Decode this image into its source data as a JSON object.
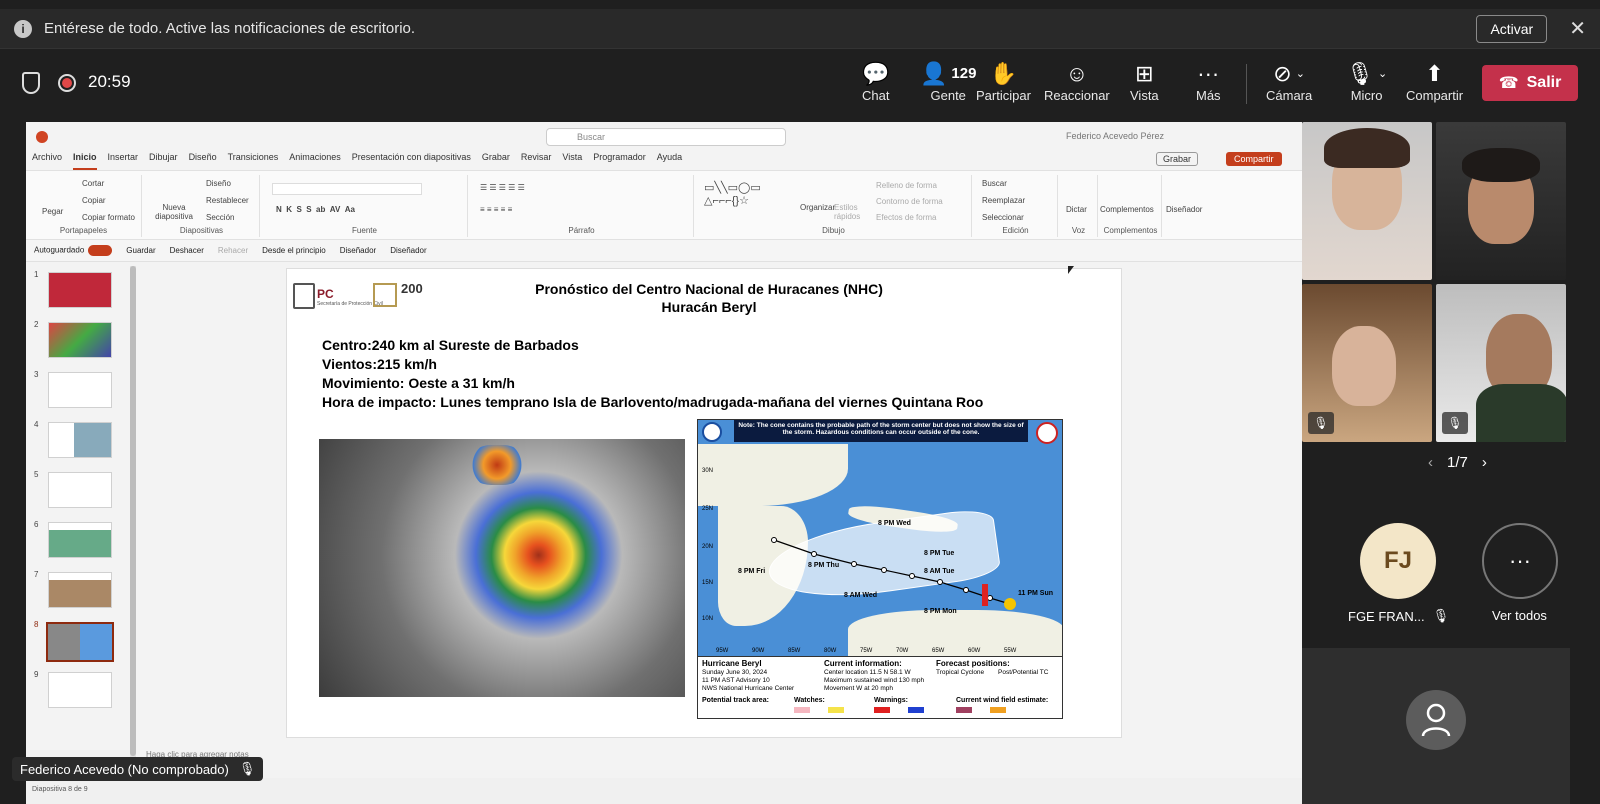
{
  "notification": {
    "text": "Entérese de todo. Active las notificaciones de escritorio.",
    "action": "Activar"
  },
  "call": {
    "timer": "20:59",
    "people_count": "129",
    "leave": "Salir"
  },
  "toolbar": [
    {
      "label": "Chat",
      "icon": "chat-icon"
    },
    {
      "label": "Gente",
      "icon": "people-icon"
    },
    {
      "label": "Participar",
      "icon": "hand-icon"
    },
    {
      "label": "Reaccionar",
      "icon": "smile-icon"
    },
    {
      "label": "Vista",
      "icon": "grid-icon"
    },
    {
      "label": "Más",
      "icon": "more-icon"
    },
    {
      "label": "Cámara",
      "icon": "camera-off-icon"
    },
    {
      "label": "Micro",
      "icon": "mic-off-icon"
    },
    {
      "label": "Compartir",
      "icon": "share-icon"
    }
  ],
  "ppt": {
    "search": "Buscar",
    "user": "Federico Acevedo Pérez",
    "menu": [
      "Archivo",
      "Inicio",
      "Insertar",
      "Dibujar",
      "Diseño",
      "Transiciones",
      "Animaciones",
      "Presentación con diapositivas",
      "Grabar",
      "Revisar",
      "Vista",
      "Programador",
      "Ayuda"
    ],
    "grabar": "Grabar",
    "compartir": "Compartir",
    "ribbon_groups": [
      "Portapapeles",
      "Diapositivas",
      "Fuente",
      "Párrafo",
      "Dibujo",
      "Edición",
      "Voz",
      "Complementos"
    ],
    "clip": {
      "pegar": "Pegar",
      "cortar": "Cortar",
      "copiar": "Copiar",
      "formato": "Copiar formato"
    },
    "slides": {
      "nueva": "Nueva diapositiva",
      "diseno": "Diseño",
      "restablecer": "Restablecer",
      "seccion": "Sección"
    },
    "drawing": {
      "organizar": "Organizar",
      "estilos": "Estilos rápidos",
      "relleno": "Relleno de forma",
      "contorno": "Contorno de forma",
      "efectos": "Efectos de forma"
    },
    "edit": {
      "buscar": "Buscar",
      "reemplazar": "Reemplazar",
      "seleccionar": "Seleccionar"
    },
    "voz": "Dictar",
    "complementos": "Complementos",
    "disenador": "Diseñador",
    "qat": {
      "autoguardado": "Autoguardado",
      "guardar": "Guardar",
      "deshacer": "Deshacer",
      "rehacer": "Rehacer",
      "desde": "Desde el principio",
      "disenador1": "Diseñador",
      "disenador2": "Diseñador"
    },
    "thumbs": [
      "1",
      "2",
      "3",
      "4",
      "5",
      "6",
      "7",
      "8",
      "9"
    ],
    "notes": "Haga clic para agregar notas",
    "status": "Diapositiva 8 de 9"
  },
  "slide": {
    "pc": "PC",
    "pc_sub": "Secretaría de Protección Civil",
    "logo200": "200",
    "title1": "Pronóstico del Centro Nacional de Huracanes (NHC)",
    "title2": "Huracán Beryl",
    "bullets": [
      "Centro:240 km al Sureste de Barbados",
      "Vientos:215 km/h",
      "Movimiento: Oeste a 31 km/h",
      "Hora de impacto: Lunes temprano Isla de Barlovento/madrugada-mañana del viernes Quintana Roo"
    ],
    "map": {
      "note": "Note: The cone contains the probable path of the storm center but does not show the size of the storm. Hazardous conditions can occur outside of the cone.",
      "tracks": [
        "8 PM Wed",
        "8 PM Tue",
        "8 AM Tue",
        "8 PM Fri",
        "8 PM Thu",
        "8 AM Wed",
        "8 PM Mon",
        "11 PM Sun"
      ],
      "lats": [
        "30N",
        "25N",
        "20N",
        "15N",
        "10N"
      ],
      "lons": [
        "95W",
        "90W",
        "85W",
        "80W",
        "75W",
        "70W",
        "65W",
        "60W",
        "55W"
      ],
      "legend_name": "Hurricane Beryl",
      "legend_date": "Sunday June 30, 2024",
      "legend_adv": "11 PM AST Advisory 10",
      "legend_src": "NWS National Hurricane Center",
      "current": "Current information:",
      "cur1": "Center location 11.5 N 58.1 W",
      "cur2": "Maximum sustained wind 130 mph",
      "cur3": "Movement W at 20 mph",
      "forecast": "Forecast positions:",
      "fc1": "Tropical Cyclone",
      "fc2": "Post/Potential TC",
      "track_area": "Potential track area:",
      "watches": "Watches:",
      "warnings": "Warnings:",
      "wind": "Current wind field estimate:"
    }
  },
  "speaker": "Federico Acevedo (No comprobado)",
  "gallery": {
    "pager": "1/7",
    "fj_initials": "FJ",
    "fj_name": "FGE FRAN...",
    "more_label": "Ver todos"
  }
}
